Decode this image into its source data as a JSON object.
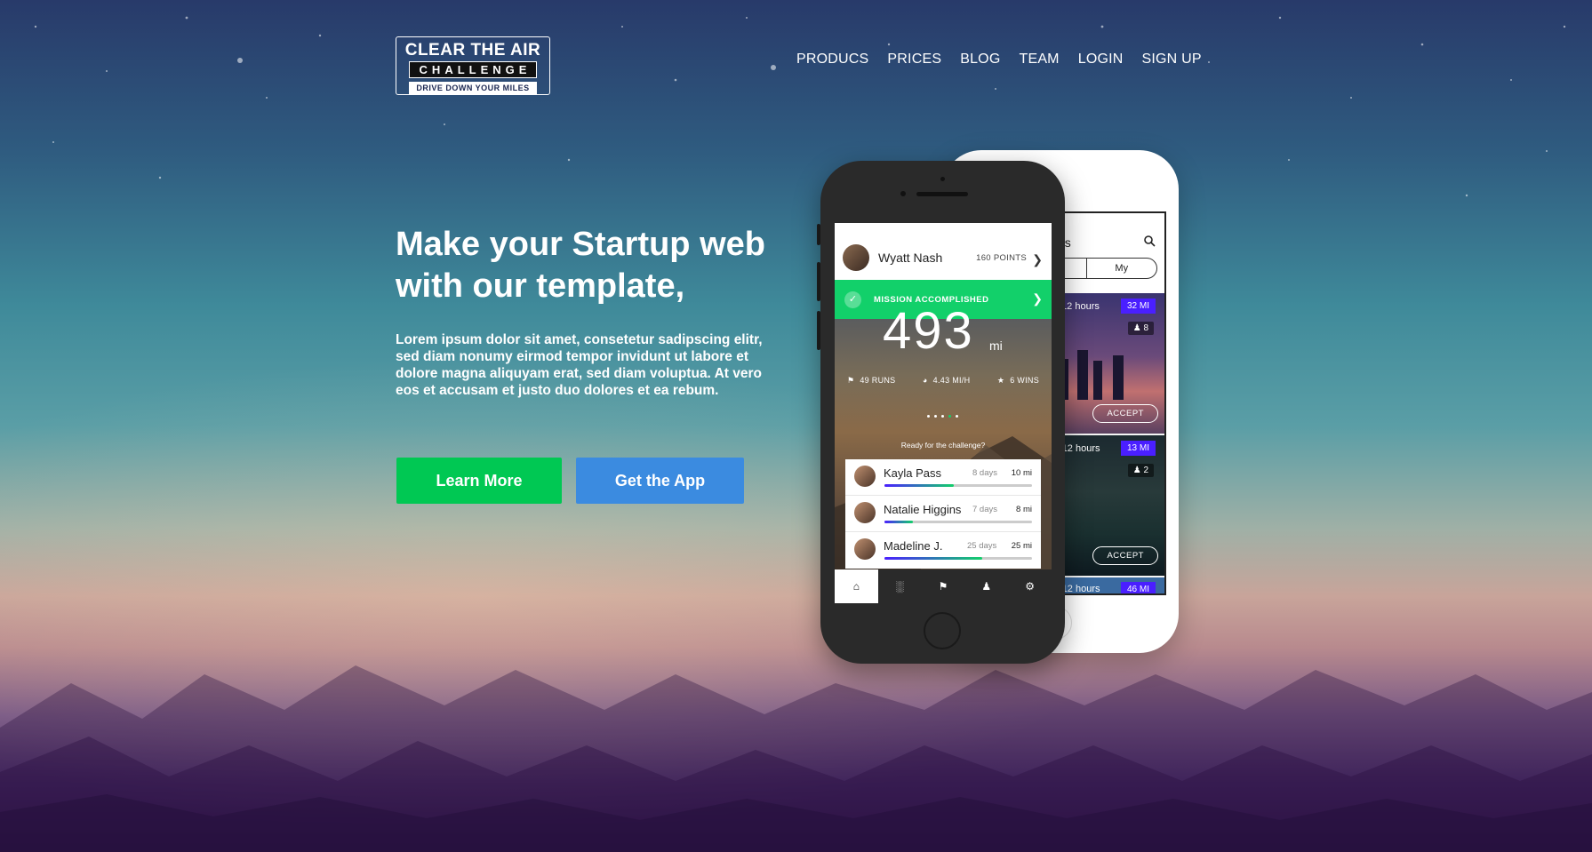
{
  "logo": {
    "line1": "CLEAR THE AIR",
    "line2": "CHALLENGE",
    "line3": "DRIVE DOWN YOUR MILES"
  },
  "nav": [
    "PRODUCS",
    "PRICES",
    "BLOG",
    "TEAM",
    "LOGIN",
    "SIGN UP"
  ],
  "hero": {
    "title": "Make your Startup web with our template,",
    "text": "Lorem ipsum dolor sit amet, consetetur sadipscing elitr, sed diam nonumy eirmod tempor invidunt ut labore et dolore magna aliquyam erat, sed diam voluptua. At vero eos et accusam et justo duo dolores et ea rebum.",
    "learn_more": "Learn More",
    "get_app": "Get the App"
  },
  "back_phone": {
    "title_fragment": "es",
    "tabs": [
      "ed",
      "My"
    ],
    "cards": [
      {
        "time": "ys 12 hours",
        "miles": "32 MI",
        "people": "8",
        "accept": "ACCEPT"
      },
      {
        "time": "ay 12 hours",
        "miles": "13 MI",
        "people": "2",
        "accept": "ACCEPT"
      },
      {
        "time": "ay 12 hours",
        "miles": "46 MI"
      }
    ]
  },
  "front_phone": {
    "user": "Wyatt Nash",
    "points": "160 POINTS",
    "mission": "MISSION ACCOMPLISHED",
    "distance": "493",
    "distance_unit": "mi",
    "stats": {
      "runs": "49 RUNS",
      "speed": "4.43 MI/H",
      "wins": "6 WINS"
    },
    "ready": "Ready for the challenge?",
    "leaderboard": [
      {
        "name": "Kayla Pass",
        "days": "8 days",
        "miles": "10 mi",
        "progress": 0.47
      },
      {
        "name": "Natalie Higgins",
        "days": "7 days",
        "miles": "8 mi",
        "progress": 0.19
      },
      {
        "name": "Madeline J.",
        "days": "25 days",
        "miles": "25 mi",
        "progress": 0.66
      }
    ]
  },
  "colors": {
    "green": "#00c853",
    "blue": "#3b8be0",
    "mission_green": "#12d06a",
    "badge_purple": "#4a1fff"
  }
}
